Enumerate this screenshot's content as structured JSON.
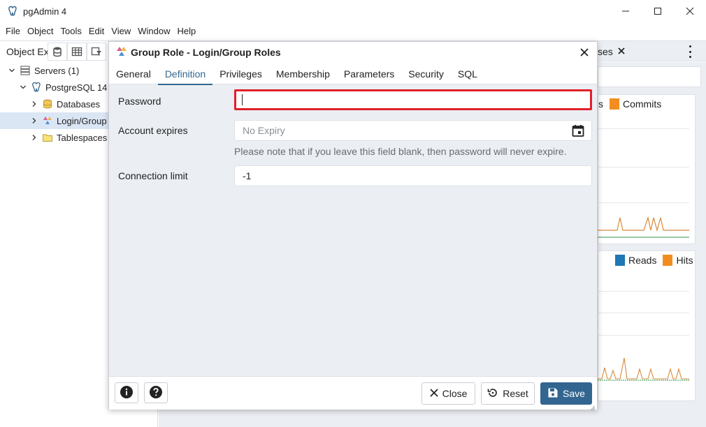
{
  "window": {
    "title": "pgAdmin 4"
  },
  "menu": [
    "File",
    "Object",
    "Tools",
    "Edit",
    "View",
    "Window",
    "Help"
  ],
  "object_explorer": {
    "tab_label": "Object Ex",
    "tree": [
      {
        "label": "Servers (1)",
        "icon": "servers-icon",
        "expanded": true
      },
      {
        "label": "PostgreSQL 14",
        "icon": "postgres-elephant-icon",
        "expanded": true
      },
      {
        "label": "Databases",
        "icon": "database-icon",
        "expanded": false
      },
      {
        "label": "Login/Group",
        "icon": "group-role-icon",
        "expanded": false,
        "selected": true
      },
      {
        "label": "Tablespaces",
        "icon": "folder-icon",
        "expanded": false
      }
    ]
  },
  "right_tab": {
    "label": "ses"
  },
  "dashboard": {
    "card1": {
      "legend_partial": "s",
      "legend": "Commits",
      "legend_color": "#f28e20"
    },
    "card2": {
      "legend": [
        {
          "name": "Reads",
          "color": "#1f77b4"
        },
        {
          "name": "Hits",
          "color": "#f28e20"
        }
      ]
    }
  },
  "dialog": {
    "title": "Group Role - Login/Group Roles",
    "tabs": [
      "General",
      "Definition",
      "Privileges",
      "Membership",
      "Parameters",
      "Security",
      "SQL"
    ],
    "active_tab": "Definition",
    "fields": {
      "password": {
        "label": "Password",
        "value": ""
      },
      "account_expires": {
        "label": "Account expires",
        "placeholder": "No Expiry"
      },
      "hint": "Please note that if you leave this field blank, then password will never expire.",
      "connection_limit": {
        "label": "Connection limit",
        "value": "-1"
      }
    },
    "footer": {
      "close_label": "Close",
      "reset_label": "Reset",
      "save_label": "Save"
    },
    "colors": {
      "accent": "#326690",
      "highlight_border": "#e0202a"
    }
  }
}
